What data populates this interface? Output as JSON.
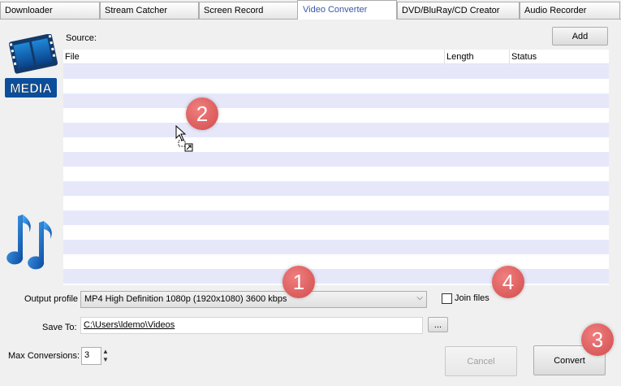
{
  "tabs": [
    {
      "label": "Downloader",
      "active": false
    },
    {
      "label": "Stream Catcher",
      "active": false
    },
    {
      "label": "Screen Record",
      "active": false
    },
    {
      "label": "Video Converter",
      "active": true
    },
    {
      "label": "DVD/BluRay/CD Creator",
      "active": false
    },
    {
      "label": "Audio Recorder",
      "active": false
    }
  ],
  "media_logo": {
    "text": "MEDIA"
  },
  "source": {
    "label": "Source:",
    "add_button": "Add"
  },
  "table": {
    "columns": [
      "File",
      "Length",
      "Status"
    ],
    "rows": []
  },
  "output_profile": {
    "label": "Output profile",
    "value": "MP4 High Definition 1080p (1920x1080) 3600 kbps"
  },
  "join_files": {
    "label": "Join files",
    "checked": false
  },
  "save_to": {
    "label": "Save To:",
    "value": "C:\\Users\\ldemo\\Videos",
    "browse_button": "..."
  },
  "max_conversions": {
    "label": "Max Conversions:",
    "value": "3"
  },
  "buttons": {
    "cancel": "Cancel",
    "convert": "Convert"
  },
  "badges": [
    "1",
    "2",
    "3",
    "4"
  ],
  "colors": {
    "accent_tab": "#3a58a8",
    "row_alt": "#e6e8fa",
    "badge": "#d9534f"
  }
}
